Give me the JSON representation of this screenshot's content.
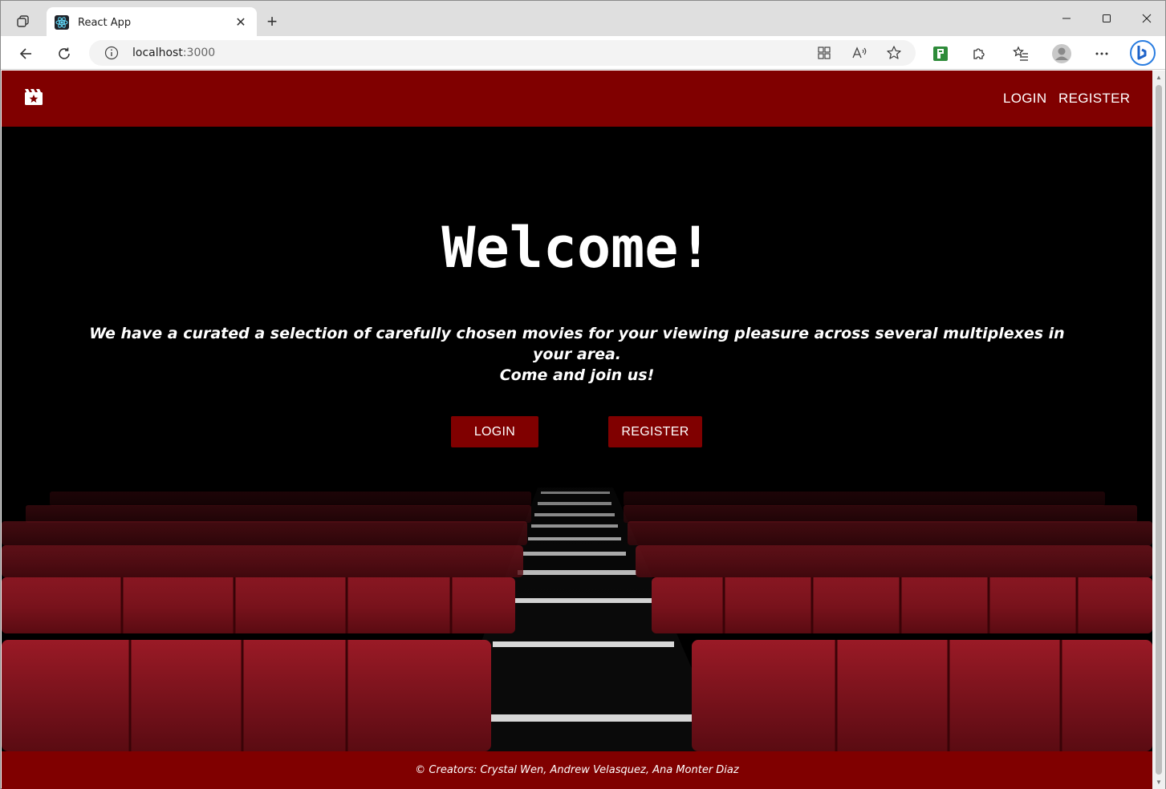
{
  "browser": {
    "tab_title": "React App",
    "tab_close": "✕",
    "new_tab": "+",
    "url_host": "localhost",
    "url_port": ":3000"
  },
  "navbar": {
    "login_label": "LOGIN",
    "register_label": "REGISTER"
  },
  "hero": {
    "title": "Welcome!",
    "text_line1": "We have a curated a selection of carefully chosen movies for your viewing pleasure across several multiplexes in your area.",
    "text_line2": "Come and join us!",
    "login_button": "LOGIN",
    "register_button": "REGISTER"
  },
  "footer": {
    "credits": "© Creators: Crystal Wen, Andrew Velasquez, Ana Monter Diaz"
  },
  "colors": {
    "brand_red": "#800000",
    "seat_red": "#8e1620"
  }
}
